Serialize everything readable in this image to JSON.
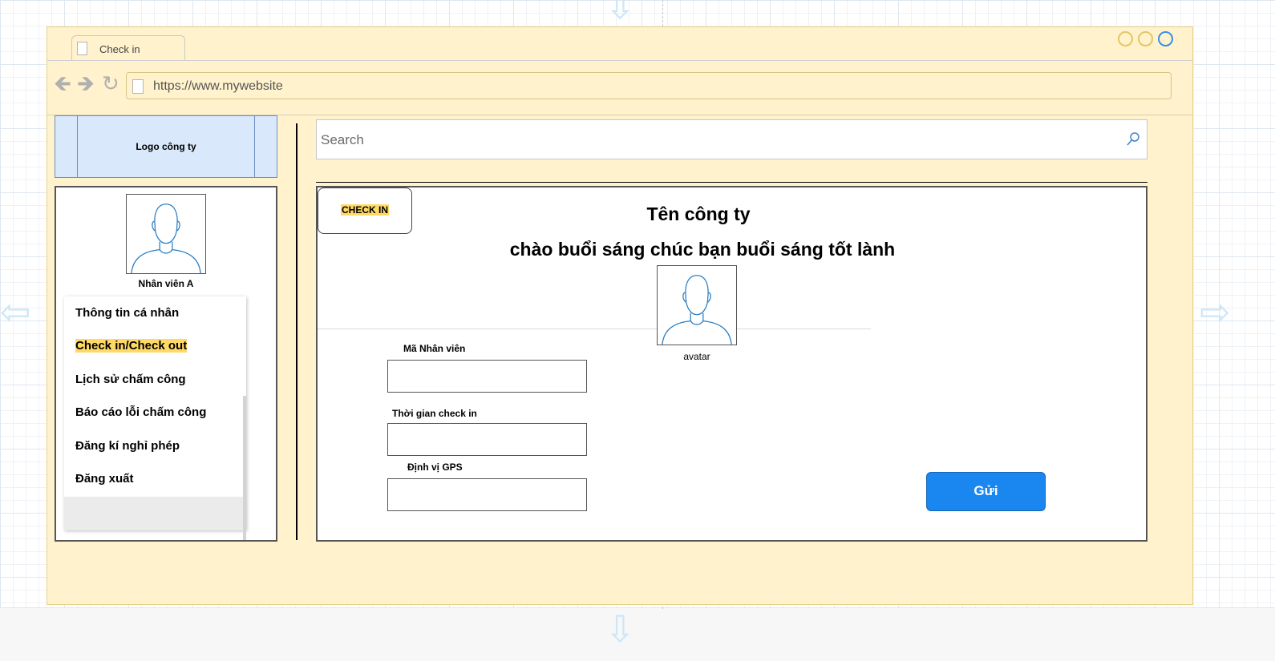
{
  "browser": {
    "tab_title": "Check in",
    "url": "https://www.mywebsite"
  },
  "logo": {
    "text": "Logo công ty"
  },
  "search": {
    "placeholder": "Search"
  },
  "employee": {
    "name": "Nhân viên A"
  },
  "sidebar": {
    "items": [
      {
        "label": "Thông tin cá nhân",
        "active": false
      },
      {
        "label": "Check in/Check out",
        "active": true
      },
      {
        "label": "Lịch sử chấm công",
        "active": false
      },
      {
        "label": "Báo cáo lỗi chấm công",
        "active": false
      },
      {
        "label": "Đăng kí nghỉ phép",
        "active": false
      },
      {
        "label": "Đăng xuất",
        "active": false
      }
    ]
  },
  "main": {
    "checkin_label": "CHECK IN",
    "company_name": "Tên công ty",
    "greeting": "chào buổi sáng chúc bạn buổi sáng tốt lành",
    "avatar_caption": "avatar",
    "fields": {
      "employee_id_label": "Mã Nhân viên",
      "checkin_time_label": "Thời gian check in",
      "gps_label": "Định vị GPS"
    },
    "submit_label": "Gửi"
  },
  "colors": {
    "frame_bg": "#fff2cc",
    "logo_bg": "#dae8fc",
    "highlight": "#ffd966",
    "primary_button": "#1a87f0"
  }
}
